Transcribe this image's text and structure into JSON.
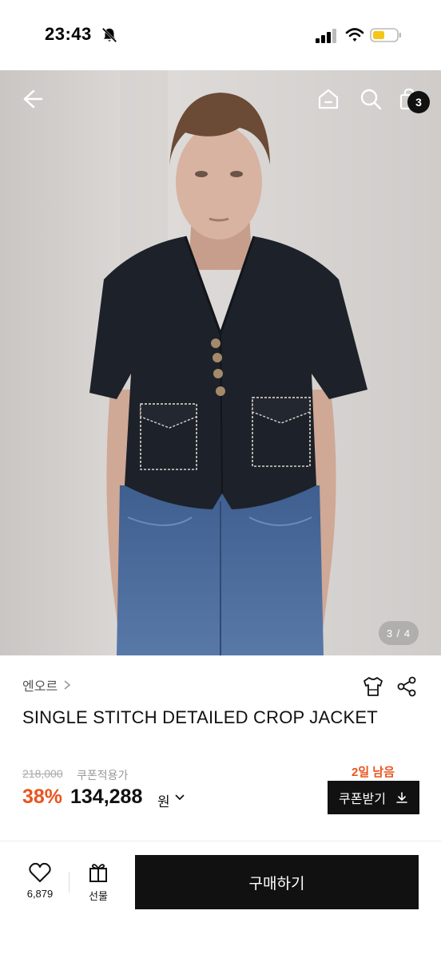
{
  "status_bar": {
    "time": "23:43",
    "icons": [
      "bell-off-icon",
      "signal-icon",
      "wifi-icon",
      "battery-icon"
    ]
  },
  "nav": {
    "icons": [
      "back-arrow-icon",
      "home-icon",
      "search-icon",
      "shopping-bag-icon"
    ],
    "cart_count": "3"
  },
  "gallery": {
    "indicator": "3 / 4"
  },
  "product": {
    "brand": "엔오르",
    "title": "SINGLE STITCH DETAILED CROP JACKET",
    "original_price": "218,000",
    "coupon_label": "쿠폰적용가",
    "discount": "38%",
    "sale_price": "134,288",
    "currency": "원",
    "coupon_deadline": "2일 남음",
    "coupon_button": "쿠폰받기"
  },
  "bottom_bar": {
    "like_count": "6,879",
    "gift_label": "선물",
    "buy_label": "구매하기"
  },
  "colors": {
    "accent": "#e9541d",
    "button_dark": "#111111"
  }
}
